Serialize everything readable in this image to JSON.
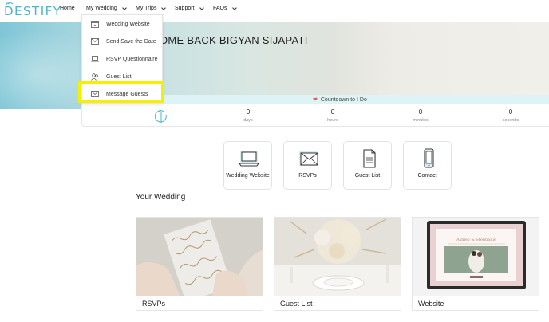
{
  "logo": {
    "text": "DESTIFY"
  },
  "nav": {
    "items": [
      {
        "label": "Home",
        "has_chevron": false
      },
      {
        "label": "My Wedding",
        "has_chevron": true
      },
      {
        "label": "My Trips",
        "has_chevron": true
      },
      {
        "label": "Support",
        "has_chevron": true
      },
      {
        "label": "FAQs",
        "has_chevron": true
      }
    ]
  },
  "dropdown": {
    "items": [
      {
        "label": "Wedding Website",
        "icon": "website-icon"
      },
      {
        "label": "Send Save the Date",
        "icon": "envelope-icon"
      },
      {
        "label": "RSVP Questionnaire",
        "icon": "laptop-icon"
      },
      {
        "label": "Guest List",
        "icon": "people-icon"
      },
      {
        "label": "Message Guests",
        "icon": "envelope-icon"
      }
    ],
    "highlighted": "Message Guests"
  },
  "hero": {
    "title": "OME BACK BIGYAN SIJAPATI"
  },
  "countdown": {
    "label": "Countdown to I Do",
    "units": [
      {
        "value": "0",
        "label": "days"
      },
      {
        "value": "0",
        "label": "hours"
      },
      {
        "value": "0",
        "label": "minutes"
      },
      {
        "value": "0",
        "label": "seconds"
      }
    ]
  },
  "tiles": [
    {
      "label": "Wedding Website",
      "icon": "laptop-icon"
    },
    {
      "label": "RSVPs",
      "icon": "envelope-icon"
    },
    {
      "label": "Guest List",
      "icon": "document-icon"
    },
    {
      "label": "Contact",
      "icon": "phone-icon"
    }
  ],
  "your_wedding": {
    "title": "Your Wedding",
    "cards": [
      {
        "caption": "RSVPs"
      },
      {
        "caption": "Guest List"
      },
      {
        "caption": "Website"
      }
    ]
  },
  "colors": {
    "brand": "#49b5c9",
    "highlight": "#f5f000",
    "heart": "#e55b5b",
    "count_bar": "#def3f5"
  }
}
